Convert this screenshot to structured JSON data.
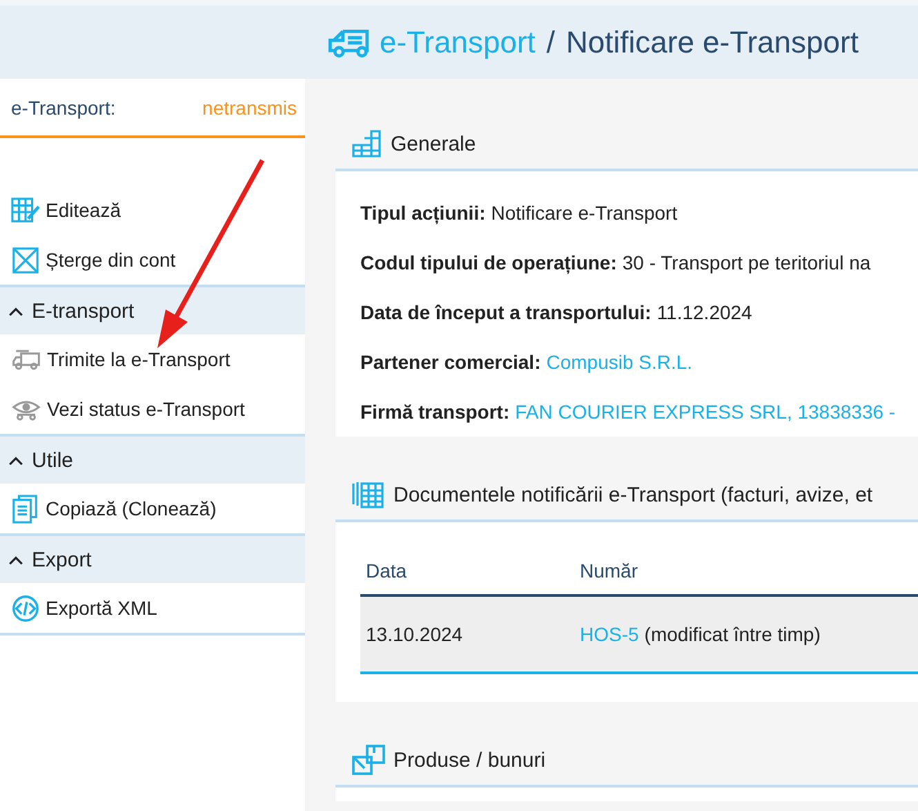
{
  "header": {
    "breadcrumb_link": "e-Transport",
    "separator": "/",
    "title": "Notificare e-Transport"
  },
  "sidebar": {
    "status": {
      "label": "e-Transport:",
      "value": "netransmis"
    },
    "groups": [
      {
        "items": [
          {
            "label": "Editează"
          },
          {
            "label": "Șterge din cont"
          }
        ]
      },
      {
        "title": "E-transport",
        "expanded": true,
        "items": [
          {
            "label": "Trimite la e-Transport"
          },
          {
            "label": "Vezi status e-Transport"
          }
        ]
      },
      {
        "title": "Utile",
        "expanded": true,
        "items": [
          {
            "label": "Copiază (Clonează)"
          }
        ]
      },
      {
        "title": "Export",
        "expanded": true,
        "items": [
          {
            "label": "Exportă XML"
          }
        ]
      }
    ]
  },
  "sections": [
    {
      "kind": "fields",
      "title": "Generale",
      "fields": [
        {
          "label": "Tipul acțiunii:",
          "value": "Notificare e-Transport",
          "link": false
        },
        {
          "label": "Codul tipului de operațiune:",
          "value": "30 - Transport pe teritoriul na",
          "link": false
        },
        {
          "label": "Data de început a transportului:",
          "value": "11.12.2024",
          "link": false
        },
        {
          "label": "Partener comercial:",
          "value": "Compusib S.R.L.",
          "link": true
        },
        {
          "label": "Firmă transport:",
          "value": "FAN COURIER EXPRESS SRL, 13838336 -",
          "link": true
        }
      ]
    },
    {
      "kind": "table",
      "title": "Documentele notificării e-Transport (facturi, avize, et",
      "columns": [
        "Data",
        "Număr"
      ],
      "rows": [
        {
          "cells": [
            {
              "text": "13.10.2024"
            },
            {
              "link": "HOS-5",
              "note": "(modificat între timp)"
            }
          ]
        }
      ]
    },
    {
      "kind": "empty",
      "title": "Produse / bunuri"
    }
  ],
  "annotation": {
    "kind": "arrow"
  }
}
